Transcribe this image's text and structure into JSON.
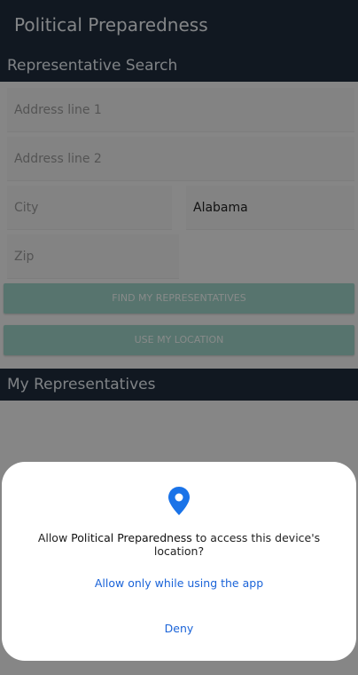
{
  "app": {
    "title": "Political Preparedness"
  },
  "search": {
    "header": "Representative Search",
    "address1_placeholder": "Address line 1",
    "address2_placeholder": "Address line 2",
    "city_placeholder": "City",
    "state_value": "Alabama",
    "zip_placeholder": "Zip",
    "find_button": "FIND MY REPRESENTATIVES",
    "location_button": "USE MY LOCATION"
  },
  "representatives": {
    "header": "My Representatives"
  },
  "permission_dialog": {
    "icon": "location-pin-icon",
    "prompt_prefix": "Allow ",
    "app_name": "Political Preparedness",
    "prompt_suffix": " to access this device's location?",
    "allow_label": "Allow only while using the app",
    "deny_label": "Deny"
  },
  "colors": {
    "appbar": "#1f2c3d",
    "button": "#9ed4c9",
    "dialog_action": "#1a63d8",
    "pin": "#1a73e8"
  }
}
